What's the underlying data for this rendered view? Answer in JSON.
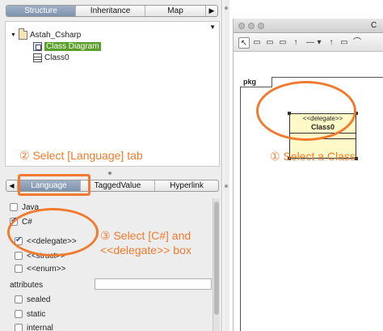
{
  "left": {
    "top_tabs": [
      "Structure",
      "Inheritance",
      "Map"
    ],
    "top_tab_arrow": "▶",
    "tree": {
      "dropdown": "▼",
      "toggle": "▼",
      "root": "Astah_Csharp",
      "children": [
        "Class Diagram",
        "Class0"
      ]
    },
    "bottom_tabs": {
      "arrow_left": "◀",
      "language": "Language",
      "tagged_value": "TaggedValue",
      "hyperlink": "Hyperlink"
    },
    "props": {
      "java": "Java",
      "csharp": "C#",
      "delegate": "<<delegate>>",
      "struct": "<<struct>>",
      "enum": "<<enum>>",
      "attributes_label": "attributes",
      "sealed": "sealed",
      "static": "static",
      "internal": "internal"
    }
  },
  "right": {
    "title_text": "C",
    "toolbar": [
      "↖",
      "▭",
      "▭",
      "▭",
      "↑",
      "—",
      "▾",
      "↑",
      "▭",
      "⌒"
    ],
    "frame_label": "pkg",
    "class_box": {
      "stereotype": "<<delegate>>",
      "name": "Class0"
    }
  },
  "annotations": {
    "step1": "① Select a Class",
    "step2": "② Select [Language] tab",
    "step3_line1": "③ Select [C#] and",
    "step3_line2": "<<delegate>> box"
  },
  "colors": {
    "annotation": "#f07a2e",
    "tab_active": "#8fa2bb",
    "tree_selection": "#5a9f2a",
    "class_fill": "#fff9c8"
  }
}
